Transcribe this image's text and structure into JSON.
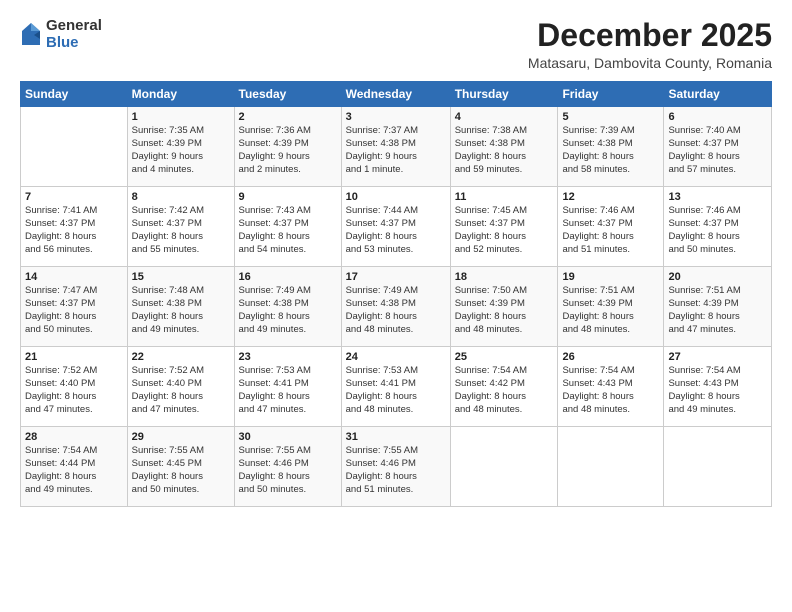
{
  "logo": {
    "general": "General",
    "blue": "Blue"
  },
  "title": "December 2025",
  "location": "Matasaru, Dambovita County, Romania",
  "days_of_week": [
    "Sunday",
    "Monday",
    "Tuesday",
    "Wednesday",
    "Thursday",
    "Friday",
    "Saturday"
  ],
  "weeks": [
    [
      {
        "day": "",
        "info": ""
      },
      {
        "day": "1",
        "info": "Sunrise: 7:35 AM\nSunset: 4:39 PM\nDaylight: 9 hours\nand 4 minutes."
      },
      {
        "day": "2",
        "info": "Sunrise: 7:36 AM\nSunset: 4:39 PM\nDaylight: 9 hours\nand 2 minutes."
      },
      {
        "day": "3",
        "info": "Sunrise: 7:37 AM\nSunset: 4:38 PM\nDaylight: 9 hours\nand 1 minute."
      },
      {
        "day": "4",
        "info": "Sunrise: 7:38 AM\nSunset: 4:38 PM\nDaylight: 8 hours\nand 59 minutes."
      },
      {
        "day": "5",
        "info": "Sunrise: 7:39 AM\nSunset: 4:38 PM\nDaylight: 8 hours\nand 58 minutes."
      },
      {
        "day": "6",
        "info": "Sunrise: 7:40 AM\nSunset: 4:37 PM\nDaylight: 8 hours\nand 57 minutes."
      }
    ],
    [
      {
        "day": "7",
        "info": "Sunrise: 7:41 AM\nSunset: 4:37 PM\nDaylight: 8 hours\nand 56 minutes."
      },
      {
        "day": "8",
        "info": "Sunrise: 7:42 AM\nSunset: 4:37 PM\nDaylight: 8 hours\nand 55 minutes."
      },
      {
        "day": "9",
        "info": "Sunrise: 7:43 AM\nSunset: 4:37 PM\nDaylight: 8 hours\nand 54 minutes."
      },
      {
        "day": "10",
        "info": "Sunrise: 7:44 AM\nSunset: 4:37 PM\nDaylight: 8 hours\nand 53 minutes."
      },
      {
        "day": "11",
        "info": "Sunrise: 7:45 AM\nSunset: 4:37 PM\nDaylight: 8 hours\nand 52 minutes."
      },
      {
        "day": "12",
        "info": "Sunrise: 7:46 AM\nSunset: 4:37 PM\nDaylight: 8 hours\nand 51 minutes."
      },
      {
        "day": "13",
        "info": "Sunrise: 7:46 AM\nSunset: 4:37 PM\nDaylight: 8 hours\nand 50 minutes."
      }
    ],
    [
      {
        "day": "14",
        "info": "Sunrise: 7:47 AM\nSunset: 4:37 PM\nDaylight: 8 hours\nand 50 minutes."
      },
      {
        "day": "15",
        "info": "Sunrise: 7:48 AM\nSunset: 4:38 PM\nDaylight: 8 hours\nand 49 minutes."
      },
      {
        "day": "16",
        "info": "Sunrise: 7:49 AM\nSunset: 4:38 PM\nDaylight: 8 hours\nand 49 minutes."
      },
      {
        "day": "17",
        "info": "Sunrise: 7:49 AM\nSunset: 4:38 PM\nDaylight: 8 hours\nand 48 minutes."
      },
      {
        "day": "18",
        "info": "Sunrise: 7:50 AM\nSunset: 4:39 PM\nDaylight: 8 hours\nand 48 minutes."
      },
      {
        "day": "19",
        "info": "Sunrise: 7:51 AM\nSunset: 4:39 PM\nDaylight: 8 hours\nand 48 minutes."
      },
      {
        "day": "20",
        "info": "Sunrise: 7:51 AM\nSunset: 4:39 PM\nDaylight: 8 hours\nand 47 minutes."
      }
    ],
    [
      {
        "day": "21",
        "info": "Sunrise: 7:52 AM\nSunset: 4:40 PM\nDaylight: 8 hours\nand 47 minutes."
      },
      {
        "day": "22",
        "info": "Sunrise: 7:52 AM\nSunset: 4:40 PM\nDaylight: 8 hours\nand 47 minutes."
      },
      {
        "day": "23",
        "info": "Sunrise: 7:53 AM\nSunset: 4:41 PM\nDaylight: 8 hours\nand 47 minutes."
      },
      {
        "day": "24",
        "info": "Sunrise: 7:53 AM\nSunset: 4:41 PM\nDaylight: 8 hours\nand 48 minutes."
      },
      {
        "day": "25",
        "info": "Sunrise: 7:54 AM\nSunset: 4:42 PM\nDaylight: 8 hours\nand 48 minutes."
      },
      {
        "day": "26",
        "info": "Sunrise: 7:54 AM\nSunset: 4:43 PM\nDaylight: 8 hours\nand 48 minutes."
      },
      {
        "day": "27",
        "info": "Sunrise: 7:54 AM\nSunset: 4:43 PM\nDaylight: 8 hours\nand 49 minutes."
      }
    ],
    [
      {
        "day": "28",
        "info": "Sunrise: 7:54 AM\nSunset: 4:44 PM\nDaylight: 8 hours\nand 49 minutes."
      },
      {
        "day": "29",
        "info": "Sunrise: 7:55 AM\nSunset: 4:45 PM\nDaylight: 8 hours\nand 50 minutes."
      },
      {
        "day": "30",
        "info": "Sunrise: 7:55 AM\nSunset: 4:46 PM\nDaylight: 8 hours\nand 50 minutes."
      },
      {
        "day": "31",
        "info": "Sunrise: 7:55 AM\nSunset: 4:46 PM\nDaylight: 8 hours\nand 51 minutes."
      },
      {
        "day": "",
        "info": ""
      },
      {
        "day": "",
        "info": ""
      },
      {
        "day": "",
        "info": ""
      }
    ]
  ]
}
